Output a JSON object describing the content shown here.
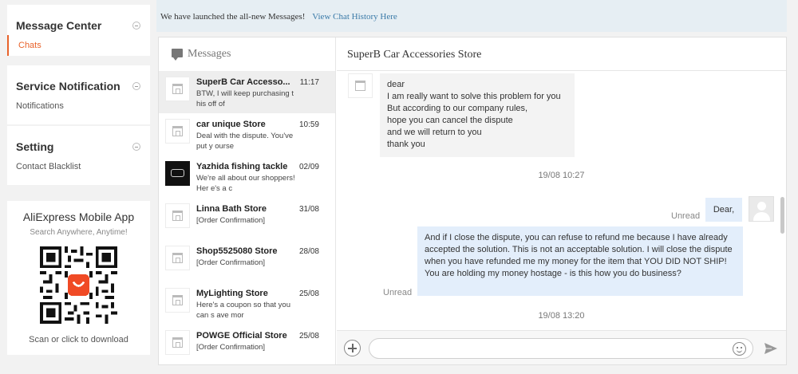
{
  "sidebar": {
    "message_center": {
      "title": "Message Center",
      "items": [
        {
          "label": "Chats",
          "active": true
        }
      ]
    },
    "service_notification": {
      "title": "Service Notification",
      "items": [
        {
          "label": "Notifications"
        }
      ]
    },
    "setting": {
      "title": "Setting",
      "items": [
        {
          "label": "Contact Blacklist"
        }
      ]
    },
    "app": {
      "title": "AliExpress Mobile App",
      "subtitle": "Search Anywhere, Anytime!",
      "download": "Scan or click to download"
    }
  },
  "banner": {
    "text": "We have launched the all-new Messages!",
    "link": "View Chat History Here"
  },
  "list": {
    "title": "Messages",
    "conversations": [
      {
        "name": "SuperB Car Accesso...",
        "date": "11:17",
        "preview": "BTW, I will keep purchasing this off of",
        "active": true
      },
      {
        "name": "car unique Store",
        "date": "10:59",
        "preview": "Deal with the dispute. You've put y ourse"
      },
      {
        "name": "Yazhida fishing tackle",
        "date": "02/09",
        "preview": "We're all about our shoppers! Her e's a c"
      },
      {
        "name": "Linna Bath Store",
        "date": "31/08",
        "preview": "[Order Confirmation]"
      },
      {
        "name": "Shop5525080 Store",
        "date": "28/08",
        "preview": "[Order Confirmation]"
      },
      {
        "name": "MyLighting Store",
        "date": "25/08",
        "preview": "Here's a coupon so that you can s ave mor"
      },
      {
        "name": "POWGE Official Store",
        "date": "25/08",
        "preview": "[Order Confirmation]"
      }
    ]
  },
  "chat": {
    "title": "SuperB Car Accessories Store",
    "incoming": {
      "lines": [
        "dear",
        "I am really want to solve this problem for you",
        "But according to our company rules,",
        "hope you can cancel the dispute",
        "and we will return to you",
        "thank you"
      ]
    },
    "timestamp1": "19/08 10:27",
    "unread1": "Unread",
    "outgoing_short": "Dear,",
    "unread2": "Unread",
    "outgoing_long": "And if I close the dispute, you can refuse to refund me because I have already accepted the solution. This is not an acceptable solution. I will close the dispute when you have refunded me my money for the item that YOU DID NOT SHIP! You are holding my money hostage - is this how you do business?",
    "timestamp2": "19/08 13:20",
    "input_value": ""
  },
  "colors": {
    "accent": "#e8622a",
    "link": "#3a7aa8",
    "outgoing_bubble": "#e3eefb",
    "incoming_bubble": "#f3f3f3"
  }
}
